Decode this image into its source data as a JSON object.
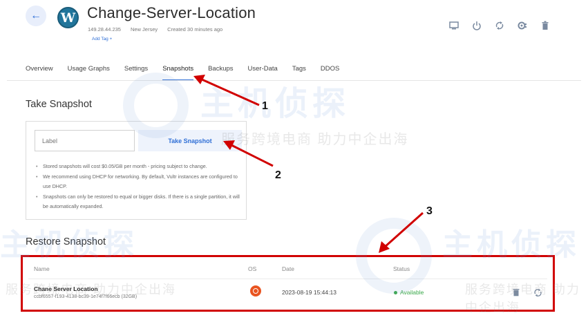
{
  "server": {
    "title": "Change-Server-Location",
    "ip": "149.28.44.235",
    "location": "New Jersey",
    "created": "Created 30 minutes ago",
    "add_tag": "Add Tag +"
  },
  "actions": [
    {
      "name": "console-icon"
    },
    {
      "name": "power-icon"
    },
    {
      "name": "restart-icon"
    },
    {
      "name": "reinstall-icon"
    },
    {
      "name": "trash-icon"
    }
  ],
  "tabs": [
    {
      "label": "Overview"
    },
    {
      "label": "Usage Graphs"
    },
    {
      "label": "Settings"
    },
    {
      "label": "Snapshots",
      "active": true
    },
    {
      "label": "Backups"
    },
    {
      "label": "User-Data"
    },
    {
      "label": "Tags"
    },
    {
      "label": "DDOS"
    }
  ],
  "take_snapshot": {
    "title": "Take Snapshot",
    "label_placeholder": "Label",
    "button": "Take Snapshot",
    "notes": [
      "Stored snapshots will cost $0.05/GB per month - pricing subject to change.",
      "We recommend using DHCP for networking. By default, Vultr instances are configured to use DHCP.",
      "Snapshots can only be restored to equal or bigger disks. If there is a single partition, it will be automatically expanded."
    ]
  },
  "restore_snapshot": {
    "title": "Restore Snapshot",
    "columns": {
      "name": "Name",
      "os": "OS",
      "date": "Date",
      "status": "Status"
    },
    "rows": [
      {
        "name": "Chane Server Location",
        "id": "ccbf6557-f193-4138-bc39-1e74f7f66ecb (32GB)",
        "os": "ubuntu-icon",
        "date": "2023-08-19 15:44:13",
        "status": "Available"
      }
    ]
  },
  "watermark": {
    "brand": "主机侦探",
    "slogan": "服务跨境电商 助力中企出海"
  },
  "annotations": [
    "1",
    "2",
    "3"
  ],
  "colors": {
    "accent": "#2f6fd6",
    "annotation_arrow": "#d10000",
    "status_ok": "#3aa84a"
  }
}
